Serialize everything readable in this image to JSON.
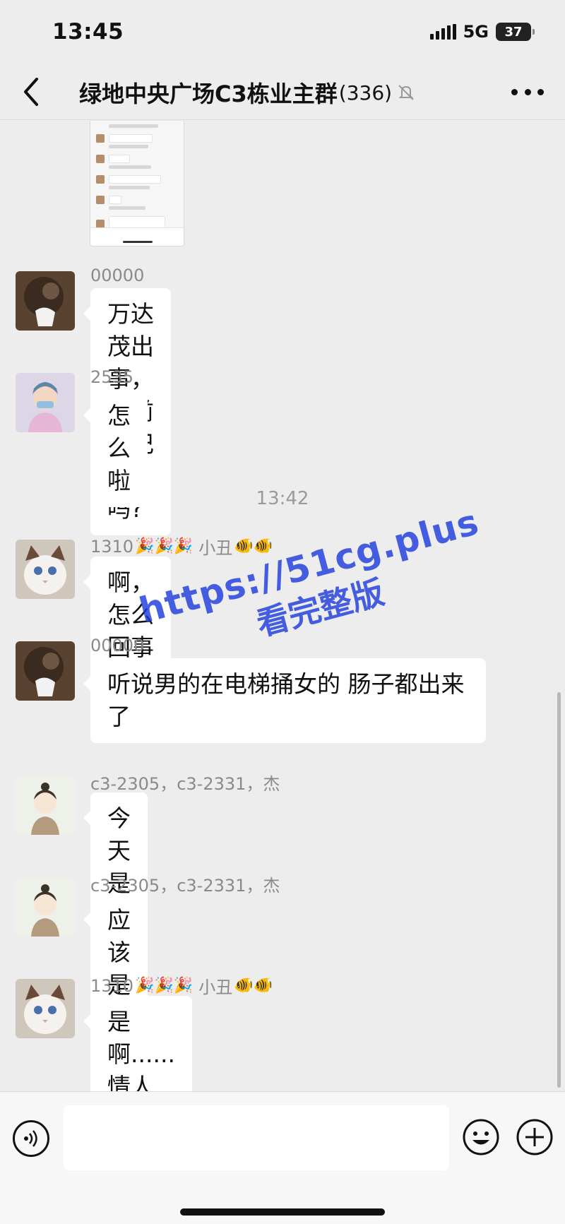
{
  "status_bar": {
    "time": "13:45",
    "network": "5G",
    "battery": "37"
  },
  "header": {
    "title": "绿地中央广场C3栋业主群",
    "member_count": "(336)"
  },
  "messages": [
    {
      "sender": "00000",
      "text": "万达茂出事，有前方记者吗?"
    },
    {
      "sender": "2535",
      "text": "怎么啦"
    },
    {
      "sender": "1310",
      "sender_suffix": "小丑",
      "text": "啊，怎么回事啊?"
    },
    {
      "sender": "00000",
      "text": "听说男的在电梯捅女的 肠子都出来了"
    },
    {
      "sender": "c3-2305，c3-2331，杰",
      "text": "今天是情人节哦"
    },
    {
      "sender": "c3-2305，c3-2331，杰",
      "text": "应该是情杀"
    },
    {
      "sender": "1310",
      "sender_suffix": "小丑",
      "text": "是啊......情人节"
    }
  ],
  "timestamp": "13:42",
  "watermark": {
    "line1": "https://51cg.plus",
    "line2": "看完整版"
  },
  "icons": {
    "back": "chevron-left-icon",
    "mute": "bell-off-icon",
    "more": "more-dots-icon",
    "voice": "voice-icon",
    "emoji": "smiley-icon",
    "plus": "plus-icon"
  }
}
